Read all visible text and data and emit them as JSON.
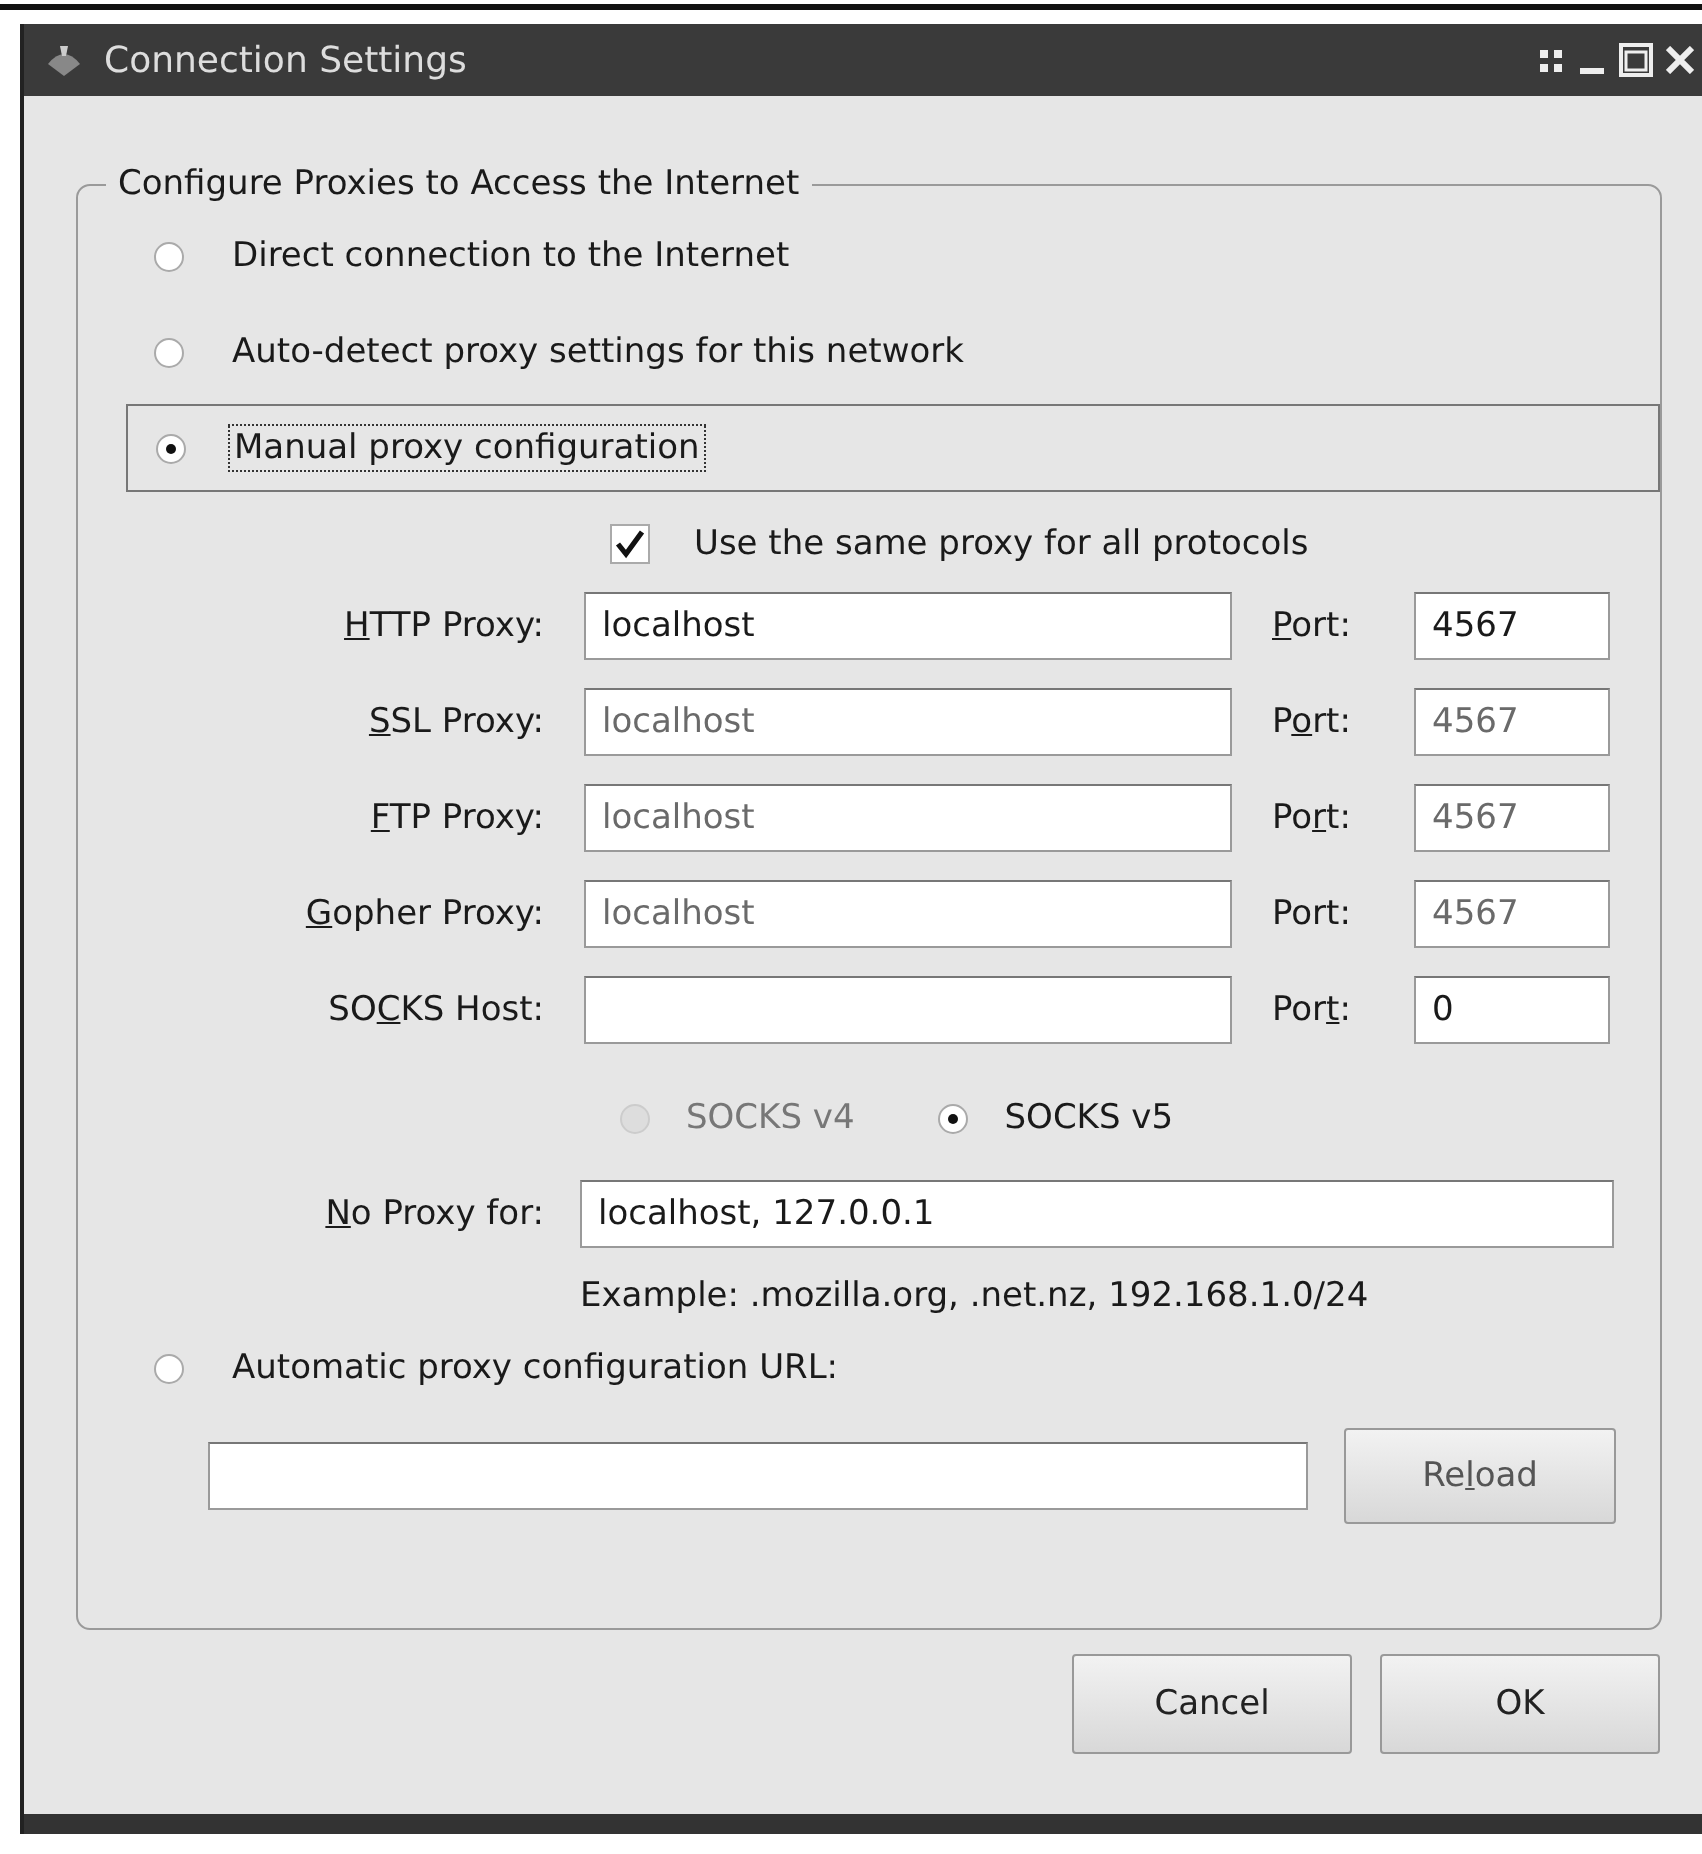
{
  "window": {
    "title": "Connection Settings"
  },
  "group": {
    "title": "Configure Proxies to Access the Internet"
  },
  "modes": [
    {
      "label": "Direct connection to the Internet",
      "selected": false,
      "focused": false
    },
    {
      "label": "Auto-detect proxy settings for this network",
      "selected": false,
      "focused": false
    },
    {
      "label": "Manual proxy configuration",
      "selected": true,
      "focused": true
    },
    {
      "label": "Automatic proxy configuration URL:",
      "selected": false,
      "focused": false
    }
  ],
  "same_proxy": {
    "label": "Use the same proxy for all protocols",
    "checked": true
  },
  "proxies": [
    {
      "label": {
        "key": "H",
        "after": "TTP Proxy:"
      },
      "host": "localhost",
      "port_label": {
        "key": "P",
        "after": "ort:"
      },
      "port": "4567",
      "disabled": false
    },
    {
      "label": {
        "key": "S",
        "after": "SL Proxy:"
      },
      "host": "localhost",
      "port_label": {
        "before": "P",
        "key": "o",
        "after": "rt:"
      },
      "port": "4567",
      "disabled": true
    },
    {
      "label": {
        "key": "F",
        "after": "TP Proxy:"
      },
      "host": "localhost",
      "port_label": {
        "before": "Po",
        "key": "r",
        "after": "t:"
      },
      "port": "4567",
      "disabled": true
    },
    {
      "label": {
        "key": "G",
        "after": "opher Proxy:"
      },
      "host": "localhost",
      "port_label": {
        "before": "Port:"
      },
      "port": "4567",
      "disabled": true
    },
    {
      "label": {
        "before": "SO",
        "key": "C",
        "after": "KS Host:"
      },
      "port_label": {
        "before": "Por",
        "key": "t",
        "after": ":"
      },
      "port": "0",
      "disabled": false
    }
  ],
  "socks_versions": [
    {
      "label": "SOCKS v4",
      "selected": false,
      "disabled": true
    },
    {
      "label": "SOCKS v5",
      "selected": true,
      "disabled": false
    }
  ],
  "no_proxy": {
    "label": {
      "key": "N",
      "after": "o Proxy for:"
    },
    "value": "localhost, 127.0.0.1",
    "example": "Example: .mozilla.org, .net.nz, 192.168.1.0/24"
  },
  "reload": {
    "before": "Re",
    "key": "l",
    "after": "oad"
  },
  "buttons": [
    "Cancel",
    "OK"
  ]
}
